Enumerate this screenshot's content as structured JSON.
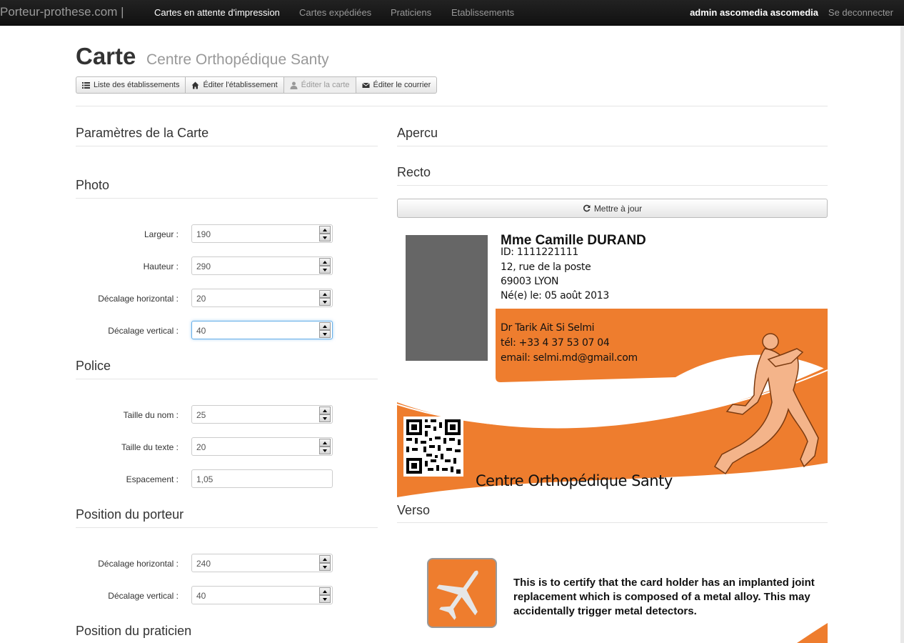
{
  "nav": {
    "brand": "Porteur-prothese.com |",
    "items": [
      {
        "label": "Cartes en attente d'impression",
        "active": true
      },
      {
        "label": "Cartes expédiées",
        "active": false
      },
      {
        "label": "Praticiens",
        "active": false
      },
      {
        "label": "Etablissements",
        "active": false
      }
    ],
    "user": "admin ascomedia ascomedia",
    "logout": "Se deconnecter"
  },
  "header": {
    "title": "Carte",
    "subtitle": "Centre Orthopédique Santy",
    "buttons": [
      {
        "label": "Liste des établissements",
        "icon": "list-icon",
        "disabled": false
      },
      {
        "label": "Éditer l'établissement",
        "icon": "home-icon",
        "disabled": false
      },
      {
        "label": "Éditer la carte",
        "icon": "user-icon",
        "disabled": true
      },
      {
        "label": "Éditer le courrier",
        "icon": "envelope-icon",
        "disabled": false
      }
    ]
  },
  "params": {
    "title": "Paramètres de la Carte",
    "photo": {
      "title": "Photo",
      "fields": [
        {
          "label": "Largeur :",
          "value": "190"
        },
        {
          "label": "Hauteur :",
          "value": "290"
        },
        {
          "label": "Décalage horizontal :",
          "value": "20"
        },
        {
          "label": "Décalage vertical :",
          "value": "40"
        }
      ]
    },
    "police": {
      "title": "Police",
      "fields": [
        {
          "label": "Taille du nom :",
          "value": "25"
        },
        {
          "label": "Taille du texte :",
          "value": "20"
        },
        {
          "label": "Espacement :",
          "value": "1,05"
        }
      ]
    },
    "porteur": {
      "title": "Position du porteur",
      "fields": [
        {
          "label": "Décalage horizontal :",
          "value": "240"
        },
        {
          "label": "Décalage vertical :",
          "value": "40"
        }
      ]
    },
    "praticien": {
      "title": "Position du praticien"
    }
  },
  "preview": {
    "title": "Apercu",
    "recto_title": "Recto",
    "update_label": "Mettre à jour",
    "card": {
      "name": "Mme Camille DURAND",
      "id": "ID: 1111221111",
      "address1": "12, rue de la poste",
      "address2": "69003 LYON",
      "birth": "Né(e) le: 05 août 2013",
      "doctor": "Dr Tarik Ait Si Selmi",
      "phone": "tél: +33 4 37 53 07 04",
      "email": "email: selmi.md@gmail.com",
      "center": "Centre Orthopédique Santy",
      "accent_color": "#ee7d2e"
    },
    "verso_title": "Verso",
    "verso_text": "This is to certify that the card holder has an implanted joint replacement which is composed of a metal alloy. This may accidentally trigger metal detectors."
  }
}
